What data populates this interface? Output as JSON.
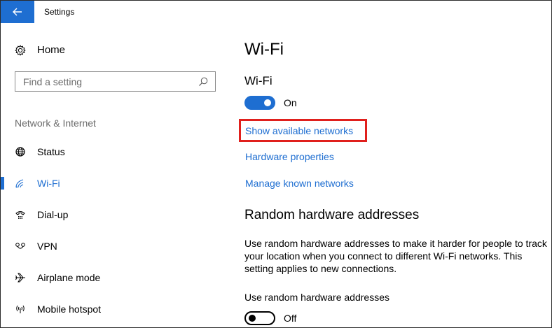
{
  "window": {
    "title": "Settings",
    "accent_color": "#1e6ed1"
  },
  "sidebar": {
    "home_label": "Home",
    "home_icon": "gear-icon",
    "search": {
      "placeholder": "Find a setting",
      "value": "",
      "icon": "search-icon"
    },
    "section_label": "Network & Internet",
    "items": [
      {
        "label": "Status",
        "icon": "globe-icon",
        "active": false
      },
      {
        "label": "Wi-Fi",
        "icon": "wifi-icon",
        "active": true
      },
      {
        "label": "Dial-up",
        "icon": "phone-icon",
        "active": false
      },
      {
        "label": "VPN",
        "icon": "vpn-icon",
        "active": false
      },
      {
        "label": "Airplane mode",
        "icon": "airplane-icon",
        "active": false
      },
      {
        "label": "Mobile hotspot",
        "icon": "hotspot-icon",
        "active": false
      }
    ]
  },
  "main": {
    "title": "Wi-Fi",
    "wifi_heading": "Wi-Fi",
    "wifi_toggle": {
      "state": "On",
      "on": true
    },
    "links": {
      "show_networks": "Show available networks",
      "hardware_properties": "Hardware properties",
      "manage_known": "Manage known networks"
    },
    "random_section": {
      "heading": "Random hardware addresses",
      "description": "Use random hardware addresses to make it harder for people to track your location when you connect to different Wi-Fi networks. This setting applies to new connections.",
      "setting_label": "Use random hardware addresses",
      "toggle": {
        "state": "Off",
        "on": false
      }
    },
    "highlight_color": "#e0201d"
  }
}
